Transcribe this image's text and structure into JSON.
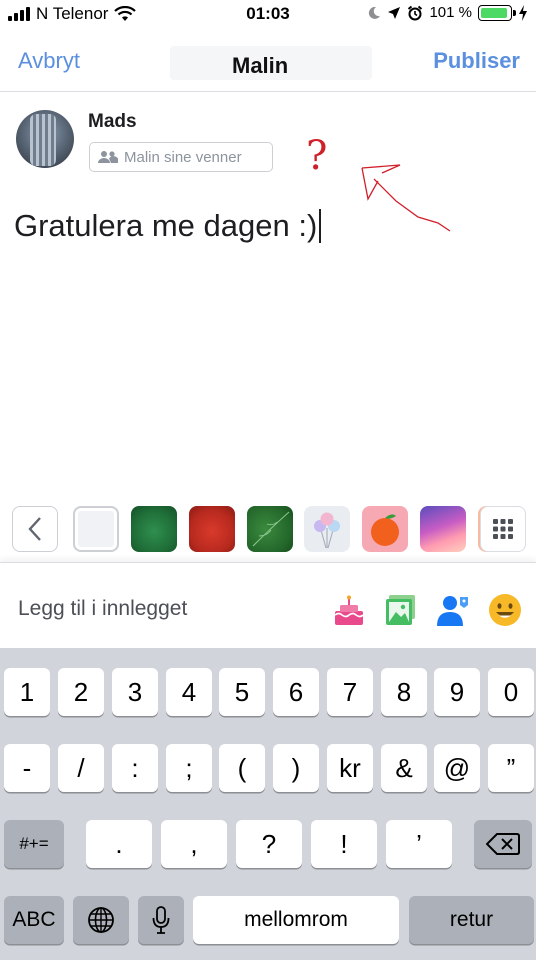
{
  "status_bar": {
    "carrier": "N Telenor",
    "time": "01:03",
    "battery": "101 %",
    "icons": [
      "signal-icon",
      "wifi-icon",
      "moon-icon",
      "location-arrow-icon",
      "alarm-icon",
      "battery-icon",
      "charging-icon"
    ]
  },
  "nav": {
    "cancel_label": "Avbryt",
    "title": "Malin",
    "publish_label": "Publiser"
  },
  "composer": {
    "author_name": "Mads",
    "audience_label": "Malin sine venner",
    "post_text": "Gratulera me dagen :)",
    "annotation_text": "?"
  },
  "background_picker": {
    "items": [
      "back-chevron-icon",
      "plain-white",
      "green-ball",
      "red-ball",
      "green-leaf",
      "balloons",
      "peach",
      "purple-wave",
      "partial-swatch",
      "grid-icon"
    ]
  },
  "add_to_post": {
    "label": "Legg til i innlegget",
    "icons": [
      "cake-icon",
      "photo-icon",
      "tag-person-icon",
      "smiley-icon"
    ]
  },
  "keyboard": {
    "row1": [
      "1",
      "2",
      "3",
      "4",
      "5",
      "6",
      "7",
      "8",
      "9",
      "0"
    ],
    "row2": [
      "-",
      "/",
      ":",
      ";",
      "(",
      ")",
      "kr",
      "&",
      "@",
      "”"
    ],
    "row3": [
      ".",
      ",",
      "?",
      "!",
      "’"
    ],
    "symbols_toggle": "#+=",
    "abc_label": "ABC",
    "space_label": "mellomrom",
    "return_label": "retur"
  },
  "colors": {
    "accent_blue": "#5b8fe0",
    "annotation_red": "#d0202a",
    "keyboard_bg": "#d1d4da"
  }
}
